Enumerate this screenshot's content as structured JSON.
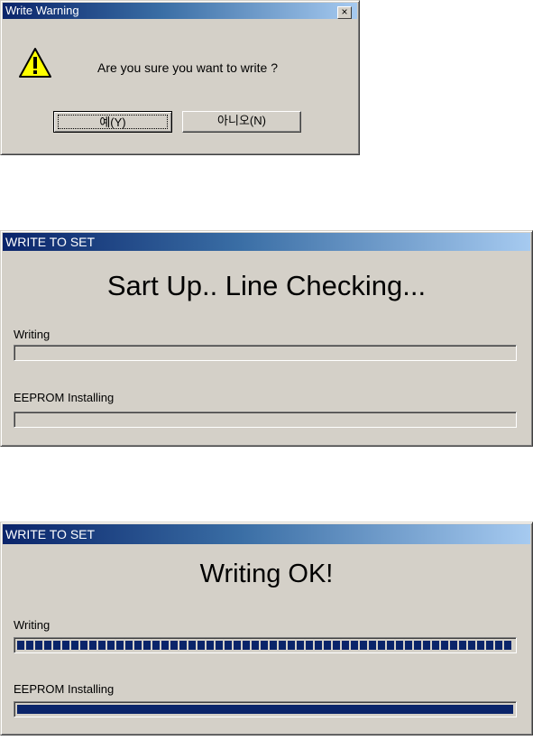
{
  "warning_dialog": {
    "title": "Write Warning",
    "close_glyph": "×",
    "icon": "warning-triangle-icon",
    "message": "Are you sure you want to write ?",
    "yes_label": "예(Y)",
    "no_label": "아니오(N)"
  },
  "progress_dialog_1": {
    "title": "WRITE TO SET",
    "status": "Sart Up.. Line Checking...",
    "writing_label": "Writing",
    "writing_progress": 0,
    "eeprom_label": "EEPROM Installing",
    "eeprom_progress": 0
  },
  "progress_dialog_2": {
    "title": "WRITE TO SET",
    "status": "Writing OK!",
    "writing_label": "Writing",
    "writing_progress": 100,
    "eeprom_label": "EEPROM Installing",
    "eeprom_progress": 100
  },
  "colors": {
    "title_gradient_start": "#0a246a",
    "title_gradient_end": "#a6caf0",
    "progress_fill": "#0a246a",
    "dialog_face": "#d4d0c8"
  }
}
